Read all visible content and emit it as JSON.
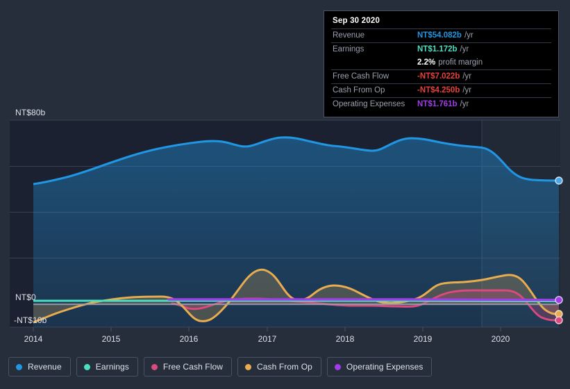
{
  "theme": {
    "background": "#272e3b",
    "plot_background": "#1b2130",
    "plot_background_forecast": "#212836",
    "gridline": "#39414f",
    "zeroline": "#9aa1ad",
    "axis_text": "#dfe3ea",
    "tooltip_background": "#000000",
    "tooltip_border": "#4a5263",
    "tooltip_label": "#9aa1ad"
  },
  "tooltip": {
    "date": "Sep 30 2020",
    "rows": [
      {
        "label": "Revenue",
        "value": "NT$54.082b",
        "unit": "/yr",
        "color": "#2196e3"
      },
      {
        "label": "Earnings",
        "value": "NT$1.172b",
        "unit": "/yr",
        "color": "#4adfc0"
      },
      {
        "label": "",
        "value": "2.2%",
        "unit": "profit margin",
        "color": "#ffffff"
      },
      {
        "label": "Free Cash Flow",
        "value": "-NT$7.022b",
        "unit": "/yr",
        "color": "#e8403a"
      },
      {
        "label": "Cash From Op",
        "value": "-NT$4.250b",
        "unit": "/yr",
        "color": "#e8403a"
      },
      {
        "label": "Operating Expenses",
        "value": "NT$1.761b",
        "unit": "/yr",
        "color": "#a03ce8"
      }
    ]
  },
  "legend": {
    "items": [
      {
        "label": "Revenue",
        "color": "#2196e3"
      },
      {
        "label": "Earnings",
        "color": "#4adfc0"
      },
      {
        "label": "Free Cash Flow",
        "color": "#d94a7e"
      },
      {
        "label": "Cash From Op",
        "color": "#e8ad50"
      },
      {
        "label": "Operating Expenses",
        "color": "#a03ce8"
      }
    ]
  },
  "axes": {
    "y_labels": {
      "top": "NT$80b",
      "zero": "NT$0",
      "bottom": "-NT$10b"
    },
    "x_labels": [
      "2014",
      "2015",
      "2016",
      "2017",
      "2018",
      "2019",
      "2020"
    ]
  },
  "chart_data": {
    "type": "area",
    "title": "",
    "xlabel": "",
    "ylabel": "NT$ (billions)",
    "ylim": [
      -10,
      80
    ],
    "xlim": [
      2013.7,
      2020.9
    ],
    "grid": true,
    "legend_position": "bottom",
    "y_ticks": [
      80,
      60,
      40,
      20,
      0,
      -10
    ],
    "y_tick_labels": [
      "NT$80b",
      "",
      "",
      "",
      "NT$0",
      "-NT$10b"
    ],
    "x_ticks": [
      2014,
      2015,
      2016,
      2017,
      2018,
      2019,
      2020
    ],
    "forecast_start": 2019.75,
    "annotations": [
      "Sep 30 2020 data point marked with endpoint dots"
    ],
    "series": [
      {
        "name": "Revenue",
        "color": "#2196e3",
        "filled": true,
        "x": [
          2013.78,
          2014.0,
          2014.25,
          2014.5,
          2014.75,
          2015.0,
          2015.25,
          2015.5,
          2015.75,
          2016.0,
          2016.25,
          2016.5,
          2016.75,
          2017.0,
          2017.25,
          2017.5,
          2017.75,
          2018.0,
          2018.25,
          2018.5,
          2018.75,
          2019.0,
          2019.25,
          2019.5,
          2019.75,
          2020.0,
          2020.25,
          2020.5,
          2020.75
        ],
        "values": [
          52.5,
          53.0,
          54.0,
          55.5,
          57.5,
          59.5,
          62.0,
          64.5,
          66.5,
          67.5,
          68.0,
          69.0,
          70.5,
          71.0,
          70.5,
          70.0,
          70.2,
          70.5,
          70.8,
          71.0,
          69.5,
          67.5,
          66.5,
          66.5,
          66.5,
          62.0,
          57.5,
          55.2,
          54.082
        ]
      },
      {
        "name": "Earnings",
        "color": "#4adfc0",
        "filled": false,
        "x": [
          2013.78,
          2014.5,
          2015.0,
          2015.5,
          2016.0,
          2017.0,
          2018.0,
          2019.0,
          2020.0,
          2020.75
        ],
        "values": [
          1.3,
          1.3,
          1.3,
          1.3,
          1.3,
          1.3,
          1.3,
          1.3,
          1.25,
          1.172
        ]
      },
      {
        "name": "Free Cash Flow",
        "color": "#d94a7e",
        "filled": true,
        "x": [
          2015.6,
          2015.9,
          2016.1,
          2016.4,
          2016.8,
          2017.1,
          2017.4,
          2017.7,
          2018.0,
          2018.3,
          2018.6,
          2018.9,
          2019.05,
          2019.2,
          2019.4,
          2019.7,
          2020.0,
          2020.25,
          2020.5,
          2020.75
        ],
        "values": [
          0.2,
          -0.5,
          -1.2,
          -0.8,
          1.0,
          2.5,
          1.5,
          0.5,
          0.2,
          -0.5,
          -1.0,
          -1.5,
          0.5,
          2.0,
          3.0,
          4.5,
          5.0,
          1.5,
          -4.0,
          -7.022
        ]
      },
      {
        "name": "Cash From Op",
        "color": "#e8ad50",
        "filled": true,
        "x": [
          2013.78,
          2014.0,
          2014.25,
          2014.5,
          2014.75,
          2015.0,
          2015.25,
          2015.5,
          2015.75,
          2016.0,
          2016.25,
          2016.5,
          2016.75,
          2017.0,
          2017.25,
          2017.5,
          2017.75,
          2018.0,
          2018.25,
          2018.5,
          2018.75,
          2019.0,
          2019.25,
          2019.5,
          2019.75,
          2020.0,
          2020.25,
          2020.5,
          2020.75
        ],
        "values": [
          -8.0,
          -6.0,
          -4.2,
          -2.8,
          -1.6,
          -0.8,
          -0.2,
          0.2,
          0.4,
          -3.0,
          -7.2,
          -5.0,
          -1.0,
          4.0,
          11.0,
          15.0,
          9.0,
          2.0,
          4.0,
          5.5,
          3.5,
          0.8,
          -1.5,
          -0.5,
          6.5,
          7.5,
          8.5,
          2.0,
          -4.25
        ]
      },
      {
        "name": "Operating Expenses",
        "color": "#a03ce8",
        "filled": false,
        "x": [
          2015.6,
          2016.0,
          2017.0,
          2018.0,
          2019.0,
          2020.0,
          2020.75
        ],
        "values": [
          1.9,
          1.9,
          1.9,
          1.9,
          1.9,
          1.85,
          1.761
        ]
      }
    ]
  }
}
